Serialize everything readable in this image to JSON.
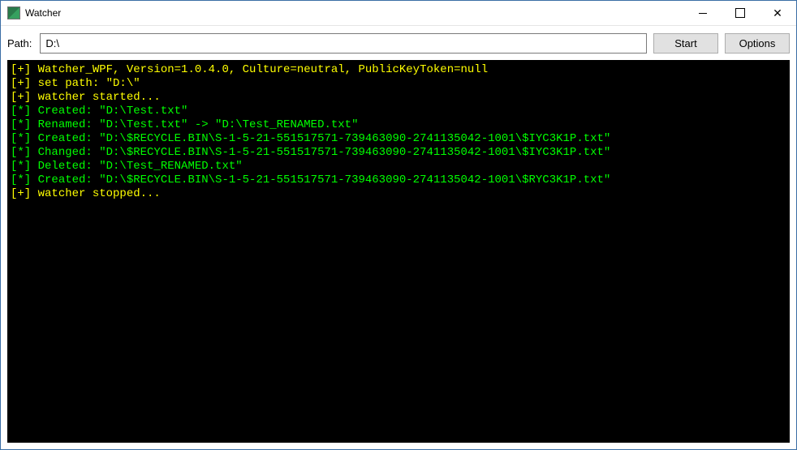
{
  "window": {
    "title": "Watcher"
  },
  "toolbar": {
    "path_label": "Path:",
    "path_value": "D:\\",
    "start_label": "Start",
    "options_label": "Options"
  },
  "console": {
    "lines": [
      {
        "kind": "info",
        "text": "Watcher_WPF, Version=1.0.4.0, Culture=neutral, PublicKeyToken=null"
      },
      {
        "kind": "info",
        "text": "set path: \"D:\\\""
      },
      {
        "kind": "info",
        "text": "watcher started..."
      },
      {
        "kind": "event",
        "text": "Created: \"D:\\Test.txt\""
      },
      {
        "kind": "event",
        "text": "Renamed: \"D:\\Test.txt\" -> \"D:\\Test_RENAMED.txt\""
      },
      {
        "kind": "event",
        "text": "Created: \"D:\\$RECYCLE.BIN\\S-1-5-21-551517571-739463090-2741135042-1001\\$IYC3K1P.txt\""
      },
      {
        "kind": "event",
        "text": "Changed: \"D:\\$RECYCLE.BIN\\S-1-5-21-551517571-739463090-2741135042-1001\\$IYC3K1P.txt\""
      },
      {
        "kind": "event",
        "text": "Deleted: \"D:\\Test_RENAMED.txt\""
      },
      {
        "kind": "event",
        "text": "Created: \"D:\\$RECYCLE.BIN\\S-1-5-21-551517571-739463090-2741135042-1001\\$RYC3K1P.txt\""
      },
      {
        "kind": "info",
        "text": "watcher stopped..."
      }
    ],
    "prefixes": {
      "info": "[+] ",
      "event": "[*] "
    }
  }
}
